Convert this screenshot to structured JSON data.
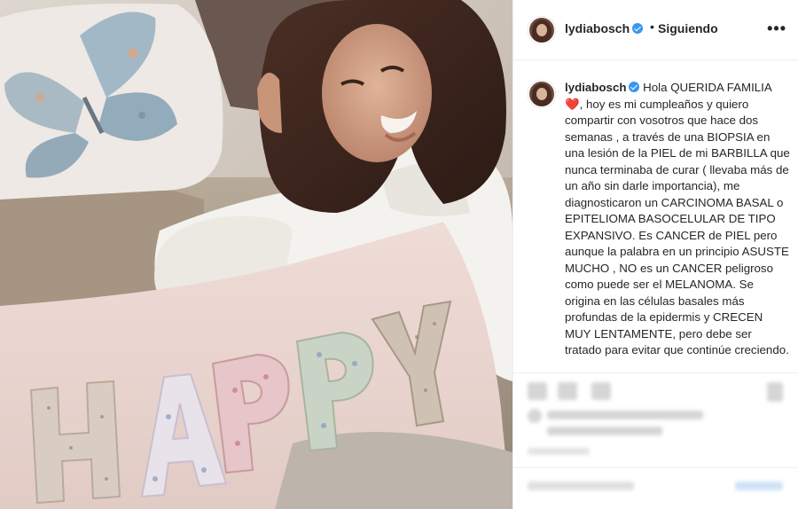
{
  "post": {
    "username": "lydiabosch",
    "separator": "•",
    "follow_status": "Siguiendo",
    "more_label": "•••",
    "caption": {
      "username": "lydiabosch",
      "text_start": "Hola QUERIDA FAMILIA",
      "heart": "❤️",
      "text_rest": ", hoy es mi cumpleaños y quiero compartir con vosotros que hace dos semanas , a través de una BIOPSIA en una lesión de la PIEL de mi BARBILLA que nunca terminaba de curar ( llevaba más de un año sin darle importancia), me diagnosticaron un CARCINOMA BASAL o EPITELIOMA BASOCELULAR DE TIPO EXPANSIVO. Es CANCER de PIEL pero aunque la palabra en un principio ASUSTE MUCHO , NO es un CANCER peligroso como puede ser el MELANOMA. Se origina en las células basales más profundas de la epidermis y CRECEN MUY LENTAMENTE, pero debe ser tratado para evitar que continúe creciendo."
    },
    "photo": {
      "pillow_text": "HAPPY"
    }
  },
  "icons": [
    "heart-icon",
    "comment-icon",
    "share-icon",
    "bookmark-icon",
    "verified-icon",
    "more-icon"
  ],
  "colors": {
    "verified": "#3897f0",
    "heart": "#e0245e",
    "text": "#262626",
    "border": "#efefef"
  }
}
